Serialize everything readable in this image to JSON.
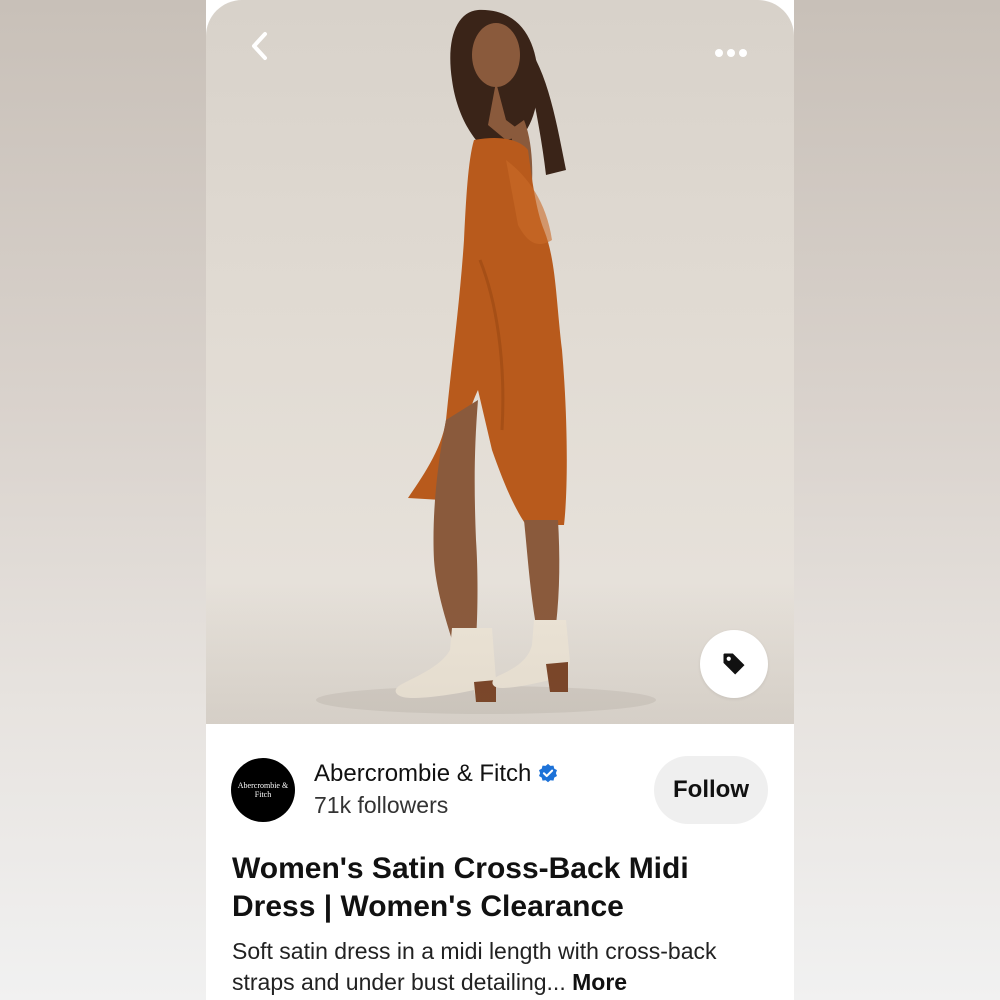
{
  "colors": {
    "follow_button_bg": "#efefef",
    "verified_badge": "#1d72d8",
    "dress": "#b85a1c",
    "boots": "#ece4d6"
  },
  "header": {
    "back_icon": "chevron-left-icon",
    "more_icon": "more-horizontal-icon"
  },
  "hero": {
    "tag_icon": "price-tag-icon"
  },
  "creator": {
    "avatar_text": "Abercrombie & Fitch",
    "name": "Abercrombie & Fitch",
    "verified_icon": "verified-badge-icon",
    "followers": "71k followers",
    "follow_label": "Follow"
  },
  "pin": {
    "title": "Women's Satin Cross-Back Midi Dress | Women's Clearance",
    "description": "Soft satin dress in a midi length with cross-back straps and under bust detailing...",
    "more_label": "More"
  }
}
